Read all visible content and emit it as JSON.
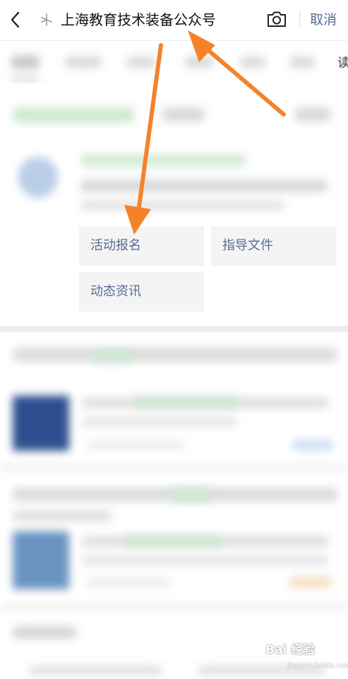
{
  "search": {
    "query": "上海教育技术装备公众号",
    "cancel_label": "取消"
  },
  "tabs": {
    "visible_partial_label": "读"
  },
  "menu": {
    "items": [
      {
        "label": "活动报名"
      },
      {
        "label": "指导文件"
      },
      {
        "label": "动态资讯"
      }
    ]
  },
  "watermark": {
    "text": "Bai 经验",
    "sub": "jingyan.baidu.com"
  },
  "colors": {
    "link": "#576b95",
    "arrow": "#f5822a",
    "cell_bg": "#f4f4f4"
  },
  "icons": {
    "back": "chevron-left-icon",
    "search_spark": "sparkle-icon",
    "camera": "camera-icon"
  }
}
